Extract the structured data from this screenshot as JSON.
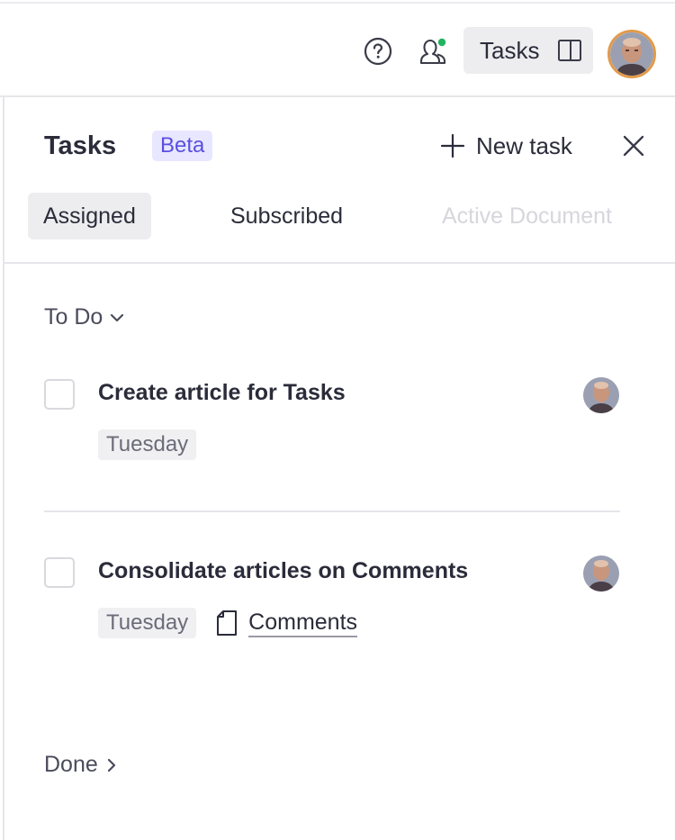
{
  "topbar": {
    "tasks_button_label": "Tasks"
  },
  "panel": {
    "title": "Tasks",
    "badge": "Beta",
    "new_task_label": "New task",
    "tabs": [
      {
        "label": "Assigned",
        "active": true
      },
      {
        "label": "Subscribed",
        "active": false
      },
      {
        "label": "Active Document",
        "active": false,
        "disabled": true
      }
    ],
    "groups": {
      "todo": {
        "label": "To Do",
        "tasks": [
          {
            "title": "Create article for Tasks",
            "due": "Tuesday",
            "document": ""
          },
          {
            "title": "Consolidate articles on Comments",
            "due": "Tuesday",
            "document": "Comments"
          }
        ]
      },
      "done": {
        "label": "Done"
      }
    }
  },
  "icons": {
    "help": "help-circle-icon",
    "presence": "users-online-icon",
    "panel_toggle": "sidebar-panel-icon",
    "plus": "plus-icon",
    "close": "close-icon",
    "chevron_down": "chevron-down-icon",
    "chevron_right": "chevron-right-icon",
    "document": "document-icon"
  },
  "colors": {
    "accent": "#5a4fe0",
    "badge_bg": "#e8e7ff",
    "online_dot": "#22b35e",
    "avatar_ring": "#e29a4a"
  }
}
